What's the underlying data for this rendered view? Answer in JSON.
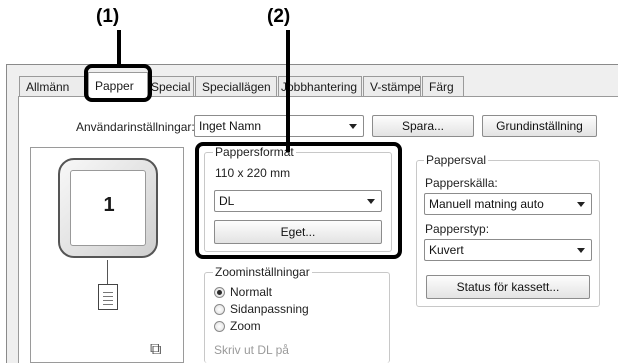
{
  "callouts": {
    "c1": "(1)",
    "c2": "(2)"
  },
  "tabs": [
    {
      "label": "Allmänn"
    },
    {
      "label": "Papper"
    },
    {
      "label": "Special"
    },
    {
      "label": "Speciallägen"
    },
    {
      "label": "Jobbhantering"
    },
    {
      "label": "V-stämpel"
    },
    {
      "label": "Färg"
    }
  ],
  "user_settings": {
    "label": "Användarinställningar:",
    "value": "Inget Namn",
    "save": "Spara...",
    "defaults": "Grundinställning"
  },
  "preview": {
    "page_number": "1"
  },
  "paper_format": {
    "legend": "Pappersformat",
    "size_text": "110 x 220 mm",
    "value": "DL",
    "custom": "Eget..."
  },
  "zoom": {
    "legend": "Zoominställningar",
    "options": [
      "Normalt",
      "Sidanpassning",
      "Zoom"
    ],
    "selected": "Normalt",
    "print_on": "Skriv ut DL på"
  },
  "paper_select": {
    "legend": "Pappersval",
    "source_label": "Papperskälla:",
    "source_value": "Manuell matning auto",
    "type_label": "Papperstyp:",
    "type_value": "Kuvert",
    "status": "Status för kassett..."
  },
  "colors": {
    "highlight": "#000000",
    "dialog_bg": "#efefef"
  }
}
